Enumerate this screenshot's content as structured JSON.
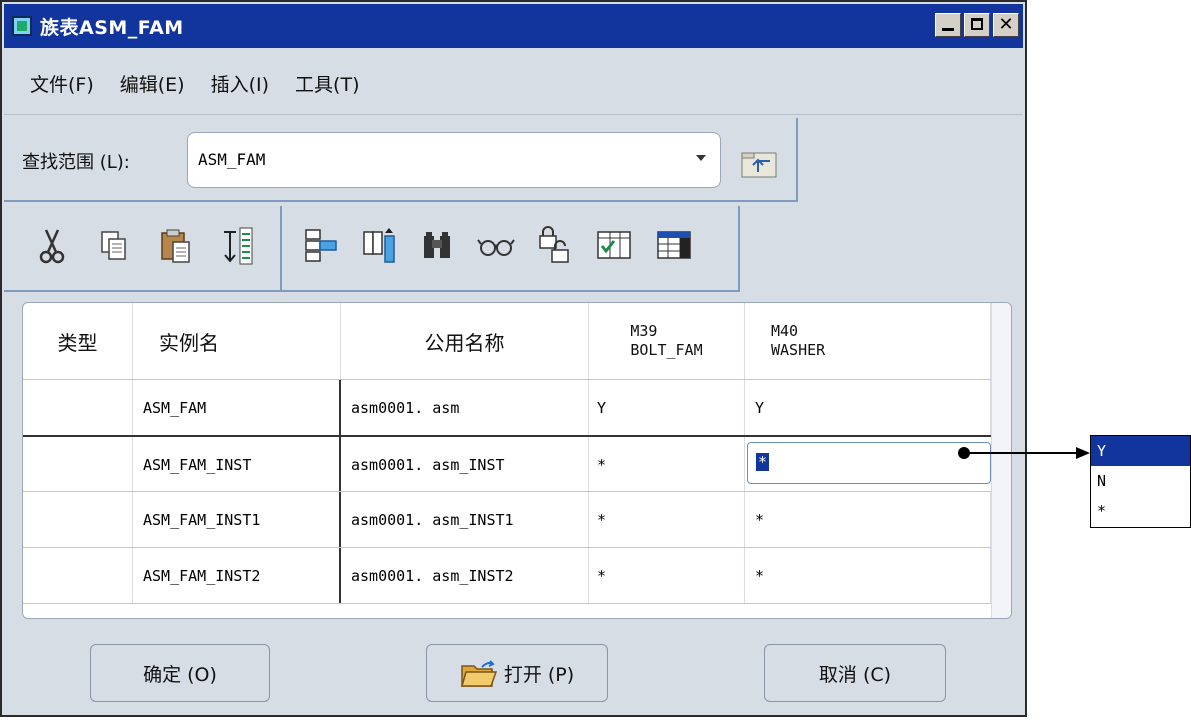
{
  "window": {
    "title": "族表ASM_FAM"
  },
  "menu": [
    "文件(F)",
    "编辑(E)",
    "插入(I)",
    "工具(T)"
  ],
  "lookin": {
    "label": "查找范围 (L):",
    "value": "ASM_FAM"
  },
  "table": {
    "headers": [
      "类型",
      "实例名",
      "公用名称",
      "M39\nBOLT_FAM",
      "M40\nWASHER"
    ],
    "rows": [
      [
        "",
        "ASM_FAM",
        "asm0001. asm",
        "Y",
        "Y"
      ],
      [
        "",
        "ASM_FAM_INST",
        "asm0001. asm_INST",
        "*",
        "*"
      ],
      [
        "",
        "ASM_FAM_INST1",
        "asm0001. asm_INST1",
        "*",
        "*"
      ],
      [
        "",
        "ASM_FAM_INST2",
        "asm0001. asm_INST2",
        "*",
        "*"
      ]
    ]
  },
  "buttons": {
    "ok": "确定 (O)",
    "open": "打开 (P)",
    "cancel": "取消 (C)"
  },
  "dropdown_options": [
    "Y",
    "N",
    "*"
  ],
  "colors": {
    "titlebar": "#12359d",
    "dialog_bg": "#d7dde5",
    "selection": "#12359d"
  }
}
